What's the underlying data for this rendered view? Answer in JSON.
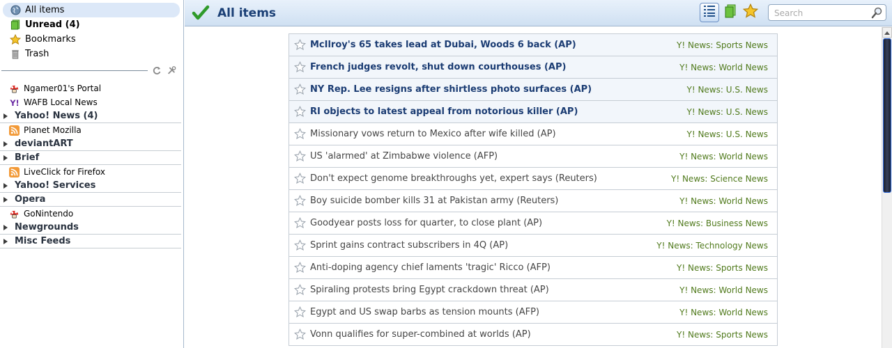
{
  "sidebar": {
    "special": [
      {
        "label": "All items",
        "icon": "globe-icon"
      },
      {
        "label": "Unread (4)",
        "icon": "green-page-icon"
      },
      {
        "label": "Bookmarks",
        "icon": "star-icon"
      },
      {
        "label": "Trash",
        "icon": "trash-icon"
      }
    ],
    "feeds": [
      {
        "type": "feed",
        "label": "Ngamer01's Portal",
        "icon": "mushroom-icon"
      },
      {
        "type": "feed",
        "label": "WAFB Local News",
        "icon": "yahoo-icon"
      },
      {
        "type": "folder",
        "label": "Yahoo! News (4)"
      },
      {
        "type": "feed",
        "label": "Planet Mozilla",
        "icon": "rss-icon"
      },
      {
        "type": "folder",
        "label": "deviantART"
      },
      {
        "type": "folder",
        "label": "Brief"
      },
      {
        "type": "feed",
        "label": "LiveClick for Firefox",
        "icon": "rss-icon"
      },
      {
        "type": "folder",
        "label": "Yahoo! Services"
      },
      {
        "type": "folder",
        "label": "Opera"
      },
      {
        "type": "feed",
        "label": "GoNintendo",
        "icon": "mushroom-icon"
      },
      {
        "type": "folder",
        "label": "Newgrounds"
      },
      {
        "type": "folder",
        "label": "Misc Feeds"
      }
    ]
  },
  "header": {
    "title": "All items",
    "search_placeholder": "Search"
  },
  "items": [
    {
      "title": "McIlroy's 65 takes lead at Dubai, Woods 6 back (AP)",
      "source": "Y! News: Sports News",
      "unread": true
    },
    {
      "title": "French judges revolt, shut down courthouses (AP)",
      "source": "Y! News: World News",
      "unread": true
    },
    {
      "title": "NY Rep. Lee resigns after shirtless photo surfaces (AP)",
      "source": "Y! News: U.S. News",
      "unread": true
    },
    {
      "title": "RI objects to latest appeal from notorious killer (AP)",
      "source": "Y! News: U.S. News",
      "unread": true
    },
    {
      "title": "Missionary vows return to Mexico after wife killed (AP)",
      "source": "Y! News: U.S. News",
      "unread": false
    },
    {
      "title": "US 'alarmed' at Zimbabwe violence (AFP)",
      "source": "Y! News: World News",
      "unread": false
    },
    {
      "title": "Don't expect genome breakthroughs yet, expert says (Reuters)",
      "source": "Y! News: Science News",
      "unread": false
    },
    {
      "title": "Boy suicide bomber kills 31 at Pakistan army (Reuters)",
      "source": "Y! News: World News",
      "unread": false
    },
    {
      "title": "Goodyear posts loss for quarter, to close plant (AP)",
      "source": "Y! News: Business News",
      "unread": false
    },
    {
      "title": "Sprint gains contract subscribers in 4Q (AP)",
      "source": "Y! News: Technology News",
      "unread": false
    },
    {
      "title": "Anti-doping agency chief laments 'tragic' Ricco (AFP)",
      "source": "Y! News: Sports News",
      "unread": false
    },
    {
      "title": "Spiraling protests bring Egypt crackdown threat (AP)",
      "source": "Y! News: World News",
      "unread": false
    },
    {
      "title": "Egypt and US swap barbs as tension mounts (AFP)",
      "source": "Y! News: World News",
      "unread": false
    },
    {
      "title": "Vonn qualifies for super-combined at worlds (AP)",
      "source": "Y! News: Sports News",
      "unread": false
    }
  ]
}
